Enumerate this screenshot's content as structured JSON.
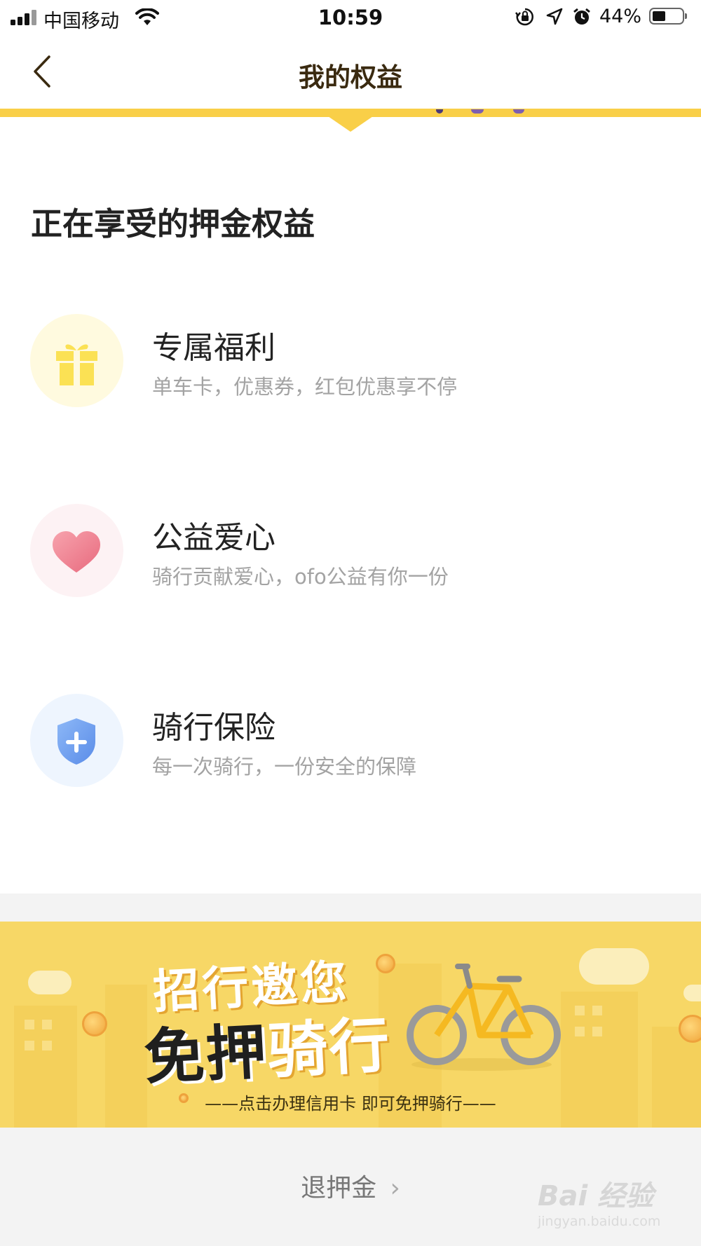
{
  "status_bar": {
    "carrier": "中国移动",
    "time": "10:59",
    "battery_percent": "44%",
    "battery_level": 0.44,
    "icons": [
      "signal-icon",
      "wifi-icon",
      "rotation-lock-icon",
      "location-arrow-icon",
      "alarm-icon",
      "battery-icon"
    ]
  },
  "nav": {
    "back_icon": "chevron-left-icon",
    "title": "我的权益"
  },
  "section": {
    "title": "正在享受的押金权益"
  },
  "benefits": [
    {
      "icon": "gift-icon",
      "title": "专属福利",
      "subtitle": "单车卡，优惠券，红包优惠享不停",
      "color": "#fbe154",
      "bg": "#fffadf"
    },
    {
      "icon": "heart-icon",
      "title": "公益爱心",
      "subtitle": "骑行贡献爱心，ofo公益有你一份",
      "color": "#ef7f8f",
      "bg": "#fdf2f4"
    },
    {
      "icon": "shield-plus-icon",
      "title": "骑行保险",
      "subtitle": "每一次骑行，一份安全的保障",
      "color": "#6f9ff0",
      "bg": "#eef5fe"
    }
  ],
  "banner": {
    "line1": "招行邀您",
    "line2_black": "免押",
    "line2_white": "骑行",
    "subtitle": "——点击办理信用卡 即可免押骑行——",
    "background": "#f7d766"
  },
  "footer": {
    "refund_label": "退押金",
    "refund_chevron": "›"
  },
  "watermark": {
    "brand": "Bai 经验",
    "url": "jingyan.baidu.com"
  },
  "colors": {
    "accent_yellow": "#f9cf48",
    "title_brown": "#3a2a10"
  }
}
